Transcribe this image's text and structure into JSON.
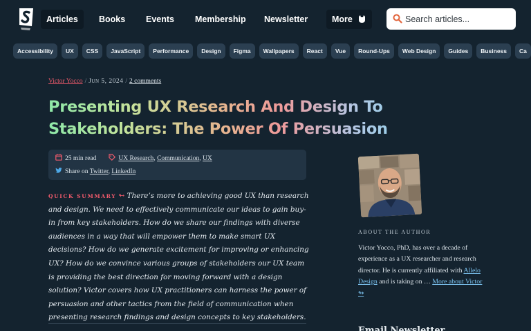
{
  "nav": {
    "items": [
      "Articles",
      "Books",
      "Events",
      "Membership",
      "Newsletter"
    ],
    "more_label": "More"
  },
  "search": {
    "placeholder": "Search articles..."
  },
  "tags": [
    "Accessibility",
    "UX",
    "CSS",
    "JavaScript",
    "Performance",
    "Design",
    "Figma",
    "Wallpapers",
    "React",
    "Vue",
    "Round-Ups",
    "Web Design",
    "Guides",
    "Business",
    "Ca"
  ],
  "article": {
    "author": "Victor Yocco",
    "date": "Jun 5, 2024",
    "comments": "2 comments",
    "title_line1": "Presenting UX Research And Design To",
    "title_line2": "Stakeholders: The Power Of Persuasion",
    "read_time": "25 min read",
    "categories": [
      "UX Research",
      "Communication",
      "UX"
    ],
    "share_label": "Share on",
    "share_links": [
      "Twitter",
      "LinkedIn"
    ],
    "summary_label": "Quick summary",
    "summary_arrow": "↬",
    "summary_text": "There’s more to achieving good UX than research and design. We need to effectively communicate our ideas to gain buy-in from key stakeholders. How do we share our findings with diverse audiences in a way that will empower them to make smart UX decisions? How do we generate excitement for improving or enhancing UX? How do we convince various groups of stakeholders our UX team is providing the best direction for moving forward with a design solution? Victor covers how UX practitioners can harness the power of persuasion and other tactics from the field of communication when presenting research findings and design concepts to key stakeholders."
  },
  "sidebar": {
    "about_label": "About The Author",
    "bio_text": "Victor Yocco, PhD, has over a decade of experience as a UX researcher and research director. He is currently affiliated with",
    "bio_link": "Allelo Design",
    "bio_tail": "and is taking on …",
    "more_link": "More about Victor",
    "more_arrow": "↬",
    "next_heading": "Email Newsletter"
  },
  "colors": {
    "background": "#14232f",
    "accent": "#ee5a6b",
    "link": "#7cc3f0",
    "tag_bg": "#2b3f51"
  }
}
